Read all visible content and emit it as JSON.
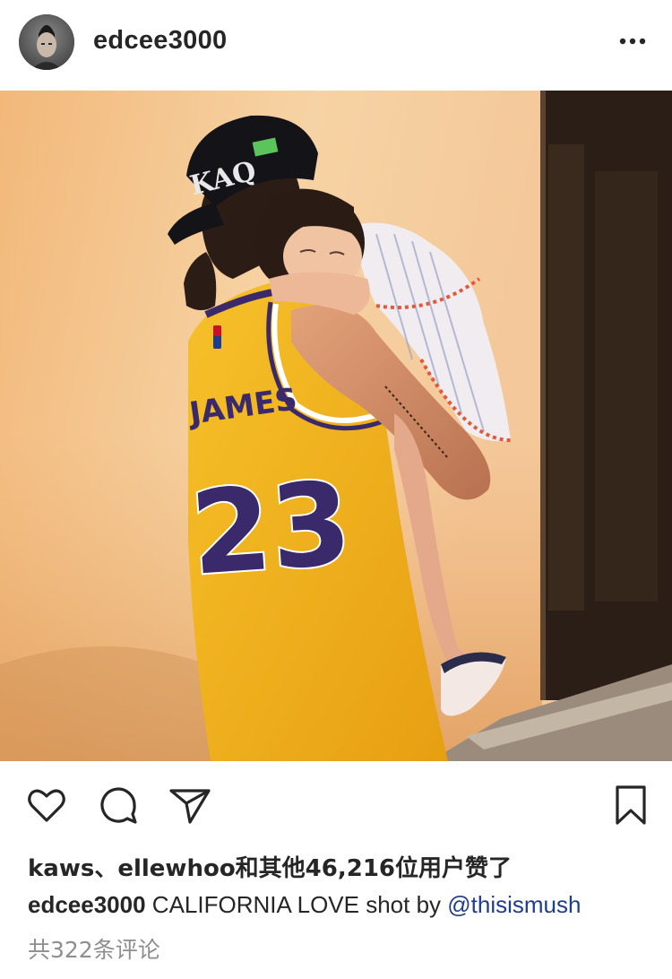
{
  "post": {
    "username": "edcee3000",
    "more_icon": "more-horizontal-icon"
  },
  "photo": {
    "jersey_name": "JAMES",
    "jersey_number": "23",
    "cap_text": "KAQ"
  },
  "actions": {
    "like_icon": "heart-icon",
    "comment_icon": "comment-icon",
    "share_icon": "paper-plane-icon",
    "save_icon": "bookmark-icon"
  },
  "likes": {
    "text": "kaws、ellewhoo和其他46,216位用户赞了"
  },
  "caption": {
    "username": "edcee3000",
    "text": "CALIFORNIA LOVE shot by",
    "mention": "@thisismush"
  },
  "comments": {
    "text": "共322条评论"
  },
  "colors": {
    "text": "#262626",
    "muted": "#8e8e8e",
    "mention": "#1e3d8f",
    "jersey_gold": "#f2b21c",
    "jersey_purple": "#3a2a6b"
  }
}
